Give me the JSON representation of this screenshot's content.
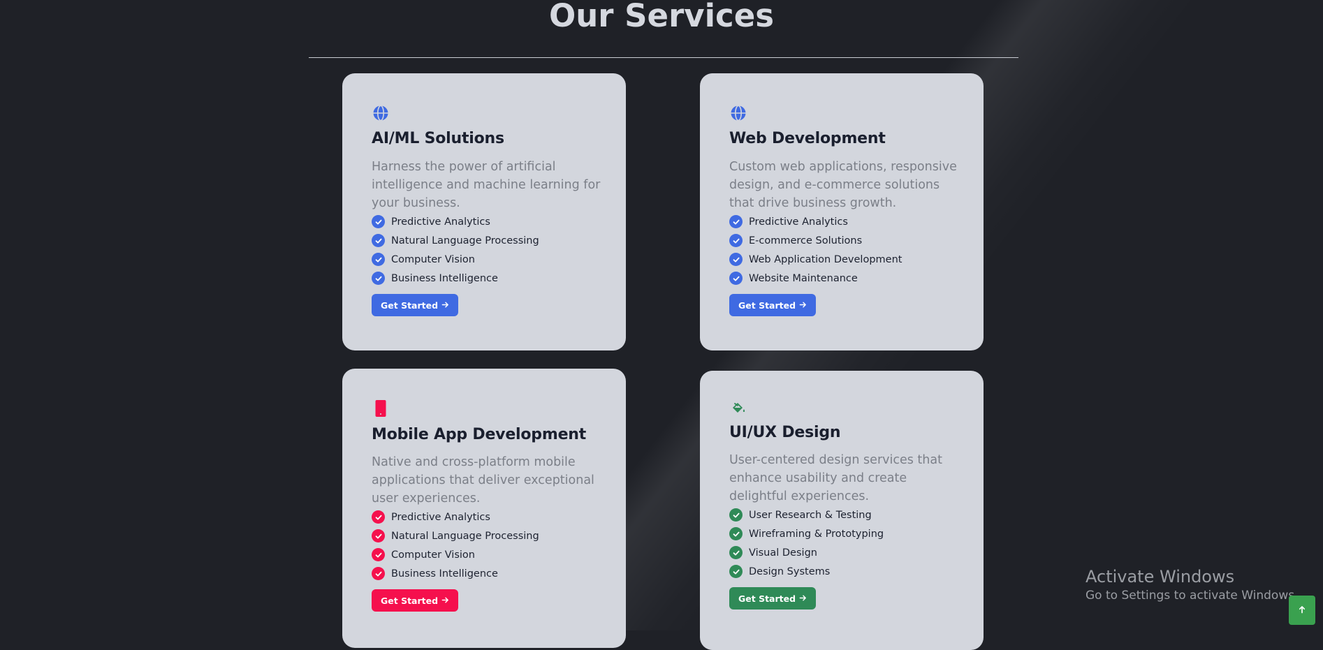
{
  "section": {
    "title": "Our Services"
  },
  "colors": {
    "page_background": "#1f2127",
    "card_background": "#d3d6dd",
    "blue_accent": "#3f6ae2",
    "red_accent": "#f5104d",
    "green_accent": "#2f8a57"
  },
  "cards": [
    {
      "icon": "globe-icon",
      "title": "AI/ML Solutions",
      "description": "Harness the power of artificial intelligence and machine learning for your business.",
      "features": [
        "Predictive Analytics",
        "Natural Language Processing",
        "Computer Vision",
        "Business Intelligence"
      ],
      "button_label": "Get Started",
      "button_icon": "arrow-right-icon",
      "accent": "#3f6ae2"
    },
    {
      "icon": "globe-icon",
      "title": "Web Development",
      "description": "Custom web applications, responsive design, and e-commerce solutions that drive business growth.",
      "features": [
        "Predictive Analytics",
        "E-commerce Solutions",
        "Web Application Development",
        "Website Maintenance"
      ],
      "button_label": "Get Started",
      "button_icon": "arrow-right-icon",
      "accent": "#3f6ae2"
    },
    {
      "icon": "mobile-phone-icon",
      "title": "Mobile App Development",
      "description": "Native and cross-platform mobile applications that deliver exceptional user experiences.",
      "features": [
        "Predictive Analytics",
        "Natural Language Processing",
        "Computer Vision",
        "Business Intelligence"
      ],
      "button_label": "Get Started",
      "button_icon": "arrow-right-icon",
      "accent": "#f5104d"
    },
    {
      "icon": "paint-bucket-icon",
      "title": "UI/UX Design",
      "description": "User-centered design services that enhance usability and create delightful experiences.",
      "features": [
        "User Research & Testing",
        "Wireframing & Prototyping",
        "Visual Design",
        "Design Systems"
      ],
      "button_label": "Get Started",
      "button_icon": "arrow-right-icon",
      "accent": "#2f8a57"
    }
  ],
  "watermark": {
    "line1": "Activate Windows",
    "line2": "Go to Settings to activate Windows."
  },
  "scroll_top_button": {
    "icon": "arrow-up-icon",
    "color": "#3aa14f"
  }
}
